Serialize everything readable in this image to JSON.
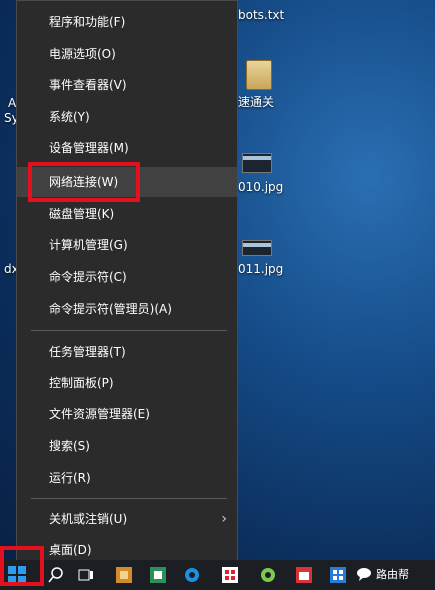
{
  "desktop": {
    "icons": [
      {
        "label": "bots.txt"
      },
      {
        "label": "速通关"
      },
      {
        "label": "010.jpg"
      },
      {
        "label": "011.jpg"
      }
    ],
    "edge_text": [
      "A",
      "Sy",
      "dx"
    ]
  },
  "menu": {
    "items": [
      {
        "label": "程序和功能(F)"
      },
      {
        "label": "电源选项(O)"
      },
      {
        "label": "事件查看器(V)"
      },
      {
        "label": "系统(Y)"
      },
      {
        "label": "设备管理器(M)"
      },
      {
        "label": "网络连接(W)"
      },
      {
        "label": "磁盘管理(K)"
      },
      {
        "label": "计算机管理(G)"
      },
      {
        "label": "命令提示符(C)"
      },
      {
        "label": "命令提示符(管理员)(A)"
      },
      {
        "label": "任务管理器(T)"
      },
      {
        "label": "控制面板(P)"
      },
      {
        "label": "文件资源管理器(E)"
      },
      {
        "label": "搜索(S)"
      },
      {
        "label": "运行(R)"
      },
      {
        "label": "关机或注销(U)"
      },
      {
        "label": "桌面(D)"
      }
    ],
    "submenu_indicator": "chevron-right-icon"
  },
  "taskbar": {
    "brand_label": "路由帮",
    "icons": [
      "start-icon",
      "search-icon",
      "task-view-icon",
      "media-icon",
      "store-icon",
      "edge-icon",
      "windows-icon",
      "app-icon",
      "calendar-icon",
      "grid-app-icon",
      "chat-icon"
    ]
  },
  "colors": {
    "highlight": "#e3101e",
    "menu_bg": "#2b2b2b"
  }
}
